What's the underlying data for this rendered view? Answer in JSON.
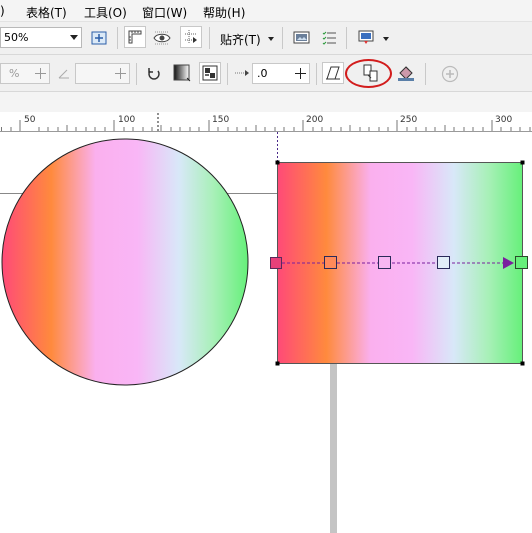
{
  "menubar": {
    "items": [
      {
        "label": ")"
      },
      {
        "label": "表格(T)"
      },
      {
        "label": "工具(O)"
      },
      {
        "label": "窗口(W)"
      },
      {
        "label": "帮助(H)"
      }
    ]
  },
  "toolbar1": {
    "zoom_value": "50%",
    "snap_label": "贴齐(T)"
  },
  "toolbar2": {
    "field1_value": "%",
    "field3_value": ".0"
  },
  "ruler": {
    "ticks": [
      "50",
      "100",
      "150",
      "200",
      "250",
      "300"
    ]
  },
  "colors": {
    "highlight": "#d21c1c",
    "gradient_stops": [
      "#ff4a78",
      "#ff8a3d",
      "#fab0ee",
      "#f9b6f6",
      "#d8e8f8",
      "#a8f0b8",
      "#66f07a"
    ],
    "interactive_arrow": "#7a1f9e",
    "start_node": "#e8407a",
    "end_node": "#66f07a"
  },
  "canvas": {
    "shapes": [
      {
        "type": "circle",
        "fill": "linear-gradient"
      },
      {
        "type": "rectangle",
        "fill": "linear-gradient",
        "selected": true
      }
    ]
  }
}
